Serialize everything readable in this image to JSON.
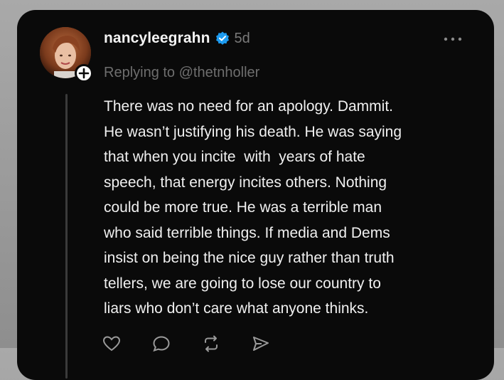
{
  "post": {
    "username": "nancyleegrahn",
    "timestamp": "5d",
    "replying_to": "Replying to @thetnholler",
    "body_lines": [
      "There was no need for an apology. Dammit.",
      "He wasn’t justifying his death. He was saying",
      "that when you incite  with  years of hate",
      "speech, that energy incites others. Nothing",
      "could be more true. He was a terrible man",
      "who said terrible things. If media and Dems",
      "insist on being the nice guy rather than truth",
      "tellers, we are going to lose our country to",
      "liars who don’t care what anyone thinks."
    ],
    "verified": true
  },
  "actions": {
    "like": {
      "icon": "heart-icon",
      "count": ""
    },
    "reply": {
      "icon": "comment-icon",
      "count": ""
    },
    "repost": {
      "icon": "repost-icon",
      "count": ""
    },
    "share": {
      "icon": "share-icon",
      "count": ""
    }
  },
  "colors": {
    "background": "#0a0a0a",
    "text": "#f0f0f0",
    "muted": "#6e6e6e",
    "verified_blue": "#1d9bf0"
  }
}
